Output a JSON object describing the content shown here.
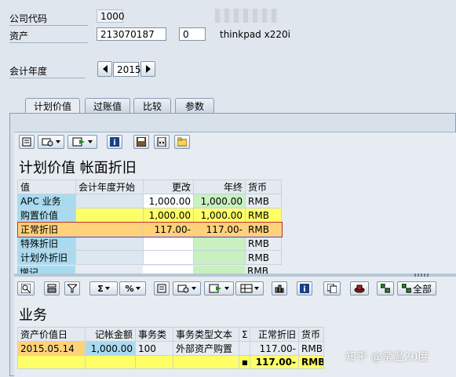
{
  "header": {
    "company_code_label": "公司代码",
    "company_code_value": "1000",
    "asset_label": "资产",
    "asset_number": "213070187",
    "asset_subnumber": "0",
    "asset_description": "thinkpad x220i",
    "fiscal_year_label": "会计年度",
    "fiscal_year_value": "2015"
  },
  "tabs": [
    {
      "label": "计划价值"
    },
    {
      "label": "过账值"
    },
    {
      "label": "比较"
    },
    {
      "label": "参数"
    }
  ],
  "top_grid": {
    "title": "计划价值 帐面折旧",
    "columns": [
      "值",
      "会计年度开始",
      "更改",
      "年终",
      "货币"
    ],
    "rows": [
      {
        "label": "APC 业务",
        "start": "",
        "change": "1,000.00",
        "year_end": "1,000.00",
        "currency": "RMB"
      },
      {
        "label": "购置价值",
        "start": "",
        "change": "1,000.00",
        "year_end": "1,000.00",
        "currency": "RMB"
      },
      {
        "label": "正常折旧",
        "start": "",
        "change": "117.00-",
        "year_end": "117.00-",
        "currency": "RMB"
      },
      {
        "label": "特殊折旧",
        "start": "",
        "change": "",
        "year_end": "",
        "currency": "RMB"
      },
      {
        "label": "计划外折旧",
        "start": "",
        "change": "",
        "year_end": "",
        "currency": "RMB"
      },
      {
        "label": "增记",
        "start": "",
        "change": "",
        "year_end": "",
        "currency": "RMB"
      }
    ]
  },
  "bottom_grid": {
    "title": "业务",
    "show_all_label": "全部",
    "columns": [
      "资产价值日",
      "记帐金额",
      "事务类",
      "事务类型文本",
      "Σ",
      "正常折旧",
      "货币"
    ],
    "rows": [
      {
        "date": "2015.05.14",
        "amount": "1,000.00",
        "trans_type": "100",
        "trans_text": "外部资产购置",
        "sigma": "",
        "depreciation": "117.00-",
        "currency": "RMB"
      }
    ],
    "total": {
      "marker": "■",
      "depreciation": "117.00-",
      "currency": "RMB"
    }
  },
  "watermark": "知乎 @常温20度",
  "colors": {
    "cyan": "#a9dbf0",
    "yellow": "#ffff66",
    "green": "#c8f0c0",
    "orange": "#ffd27a"
  }
}
